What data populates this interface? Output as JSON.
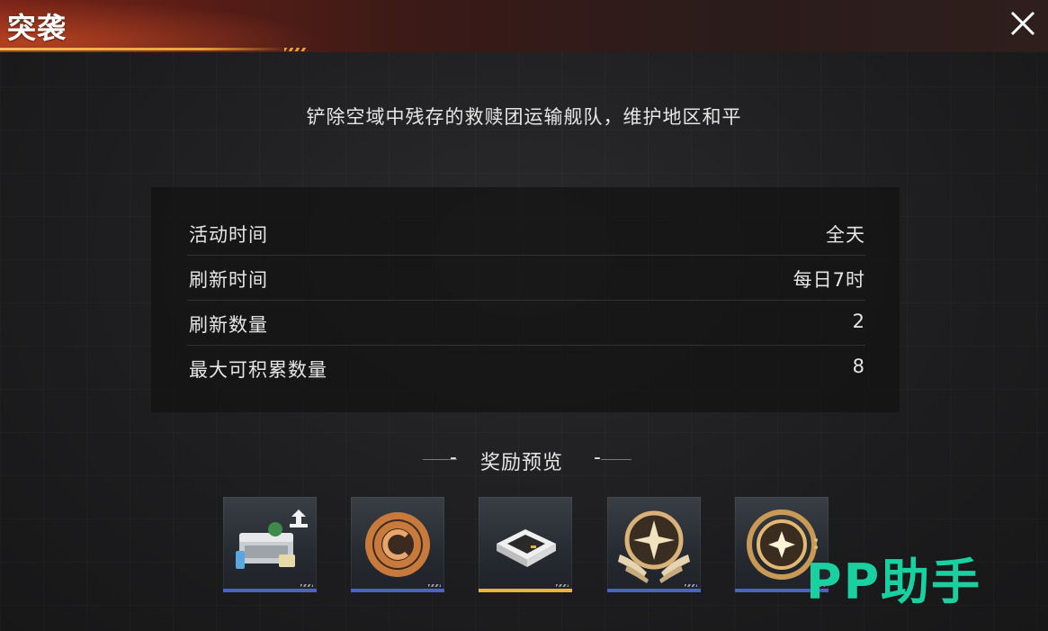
{
  "header": {
    "title": "突袭"
  },
  "description": "铲除空域中残存的救赎团运输舰队，维护地区和平",
  "info_rows": [
    {
      "label": "活动时间",
      "value": "全天"
    },
    {
      "label": "刷新时间",
      "value": "每日7时"
    },
    {
      "label": "刷新数量",
      "value": "2"
    },
    {
      "label": "最大可积累数量",
      "value": "8"
    }
  ],
  "rewards": {
    "title": "奖励预览",
    "dash_left": "-",
    "dash_right": "-",
    "items": [
      {
        "icon": "supply-crate-icon",
        "rarity_color": "#4b64c4"
      },
      {
        "icon": "copper-coin-icon",
        "rarity_color": "#4b64c4"
      },
      {
        "icon": "chip-module-icon",
        "rarity_color": "#e6b53a"
      },
      {
        "icon": "winged-star-badge-icon",
        "rarity_color": "#4b64c4"
      },
      {
        "icon": "star-coin-icon",
        "rarity_color": "#4b64c4"
      }
    ]
  },
  "watermark": "PP助手",
  "colors": {
    "header_red": "#7a2418",
    "accent_gold": "#e8a33a",
    "rarity_blue": "#4b64c4",
    "rarity_gold": "#e6b53a",
    "watermark_green": "#19d0a0"
  }
}
